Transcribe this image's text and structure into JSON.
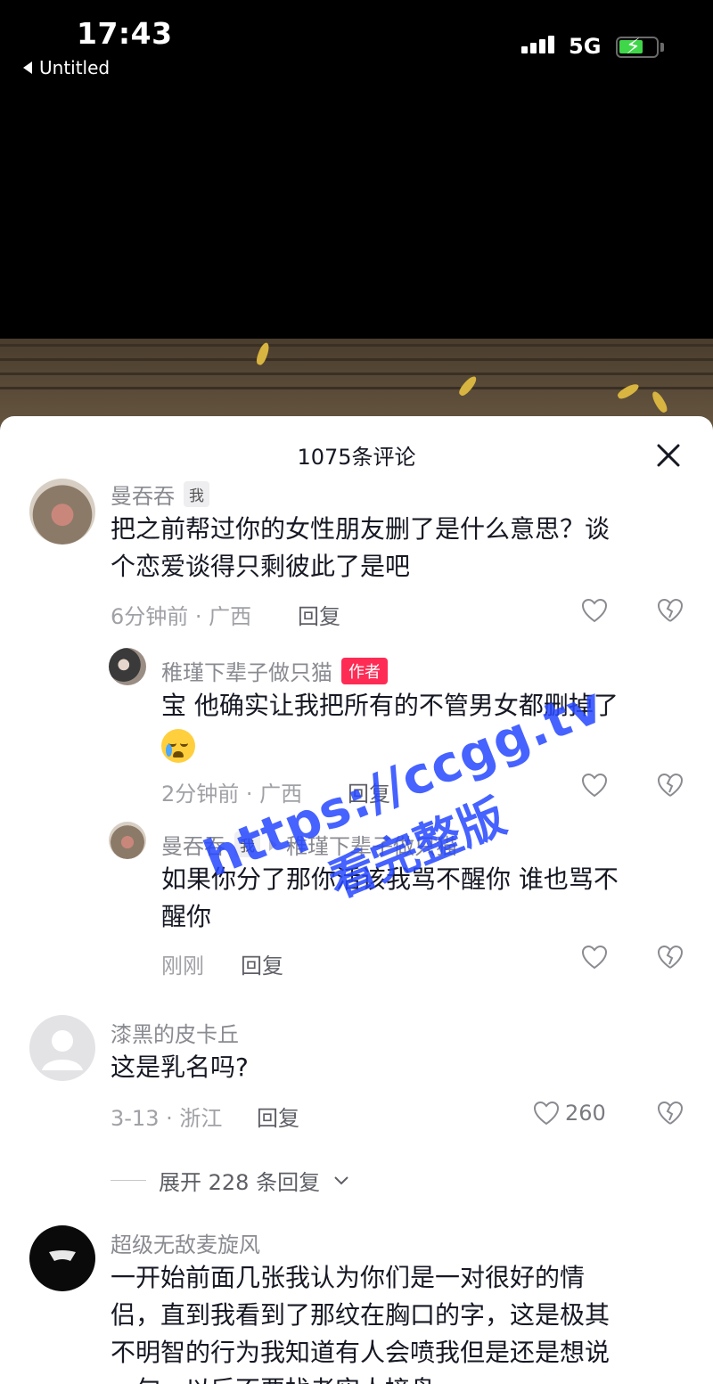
{
  "status_bar": {
    "time": "17:43",
    "back_app": "Untitled",
    "network": "5G"
  },
  "sheet": {
    "title": "1075条评论"
  },
  "comments": [
    {
      "username": "曼吞吞",
      "me_badge": "我",
      "text_line1": "把之前帮过你的女性朋友删了是什么意思？谈",
      "text_line2": "个恋爱谈得只剩彼此了是吧",
      "meta": "6分钟前 · 广西",
      "reply_label": "回复"
    },
    {
      "username": "稚瑾下辈子做只猫",
      "author_badge": "作者",
      "text": "宝 他确实让我把所有的不管男女都删掉了",
      "emoji": "crying-face",
      "meta": "2分钟前 · 广西",
      "reply_label": "回复"
    },
    {
      "username": "曼吞吞",
      "me_badge": "我",
      "reply_to": "稚瑾下辈子做只猫",
      "text_line1": "如果你分了那你活该我骂不醒你 谁也骂不",
      "text_line2": "醒你",
      "meta": "刚刚",
      "reply_label": "回复"
    },
    {
      "username": "漆黑的皮卡丘",
      "text": "这是乳名吗?",
      "meta": "3-13 · 浙江",
      "reply_label": "回复",
      "likes": "260"
    },
    {
      "username": "超级无敌麦旋风",
      "text_line1": "一开始前面几张我认为你们是一对很好的情",
      "text_line2": "侣，直到我看到了那纹在胸口的字，这是极其",
      "text_line3": "不明智的行为我知道有人会喷我但是还是想说",
      "text_line4": "一句，以后不要找老实人接盘"
    }
  ],
  "expand": {
    "label": "展开 228 条回复"
  },
  "watermark": {
    "line1": "https://ccgg.tv",
    "line2": "看完整版"
  },
  "colors": {
    "author_badge": "#fe2c55",
    "sheet_bg": "#ffffff",
    "username": "#8a8b91",
    "watermark": "#2647ff"
  }
}
